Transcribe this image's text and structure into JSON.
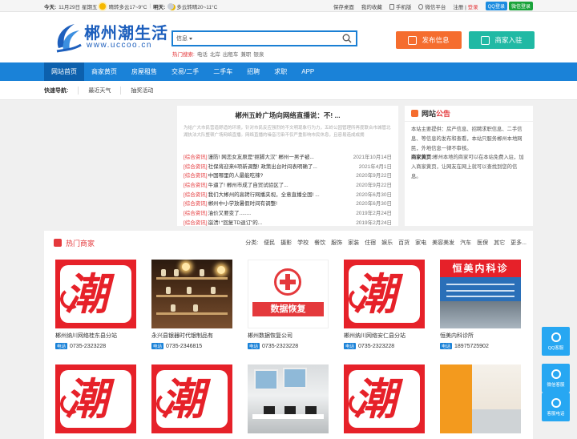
{
  "topbar": {
    "today_label": "今天:",
    "date": "11月29日 星期五",
    "today_weather": "晴转多云17~9°C",
    "tomorrow_label": "明天:",
    "tomorrow_weather": "多云转晴20~11°C",
    "links": [
      "保存桌面",
      "我的收藏",
      "手机版",
      "微信平台"
    ],
    "register": "注册",
    "login": "登录",
    "qq_login": "QQ登录",
    "wechat_login": "微信登录"
  },
  "header": {
    "logo_cn": "郴州潮生活",
    "logo_en": "www.uccoo.cn",
    "search_category": "信息",
    "search_placeholder": "",
    "hot_label": "热门搜索:",
    "hot_words": [
      "电话",
      "北岸",
      "出租车",
      "兼职",
      "银泉"
    ],
    "publish_btn": "发布信息",
    "merchant_btn": "商家入驻"
  },
  "nav": {
    "items": [
      "网站首页",
      "商家黄页",
      "房屋租售",
      "交易/二手",
      "二手车",
      "招聘",
      "求职",
      "APP"
    ]
  },
  "quick": {
    "label": "快速导航:",
    "items": [
      "最近天气",
      "抽奖活动"
    ]
  },
  "news": {
    "title": "郴州五岭广场向网络直播说：不! ...",
    "desc": "为给广大市民营造舒适的环境，针对市民反应强烈的不文明现象行为力，五岭公园管理所再度联合市城管北湖执法大队整顿广场网络直播。网络直播的噪音污染不仅严重影响市民休息，且容易造成成拥",
    "items": [
      {
        "cat": "[综合资讯]",
        "title": "谨防! 网恋女友原是“抠脚大汉” 郴州一男子被...",
        "date": "2021年10月14日"
      },
      {
        "cat": "[综合资讯]",
        "title": "社保将迎来6项新调整! 政策出台时间表明确了...",
        "date": "2021年4月1日"
      },
      {
        "cat": "[综合资讯]",
        "title": "中国哪里的人最能吃辣?",
        "date": "2020年9月22日"
      },
      {
        "cat": "[综合资讯]",
        "title": "牛逼了! 郴州市成了自贸试验区了...",
        "date": "2020年9月22日"
      },
      {
        "cat": "[综合资讯]",
        "title": "我们大郴州的高铐行网播夹视，全意直播全国! ...",
        "date": "2020年6月30日"
      },
      {
        "cat": "[综合资讯]",
        "title": "郴州中小学放暑假时间有调整!",
        "date": "2020年6月30日"
      },
      {
        "cat": "[综合资讯]",
        "title": "油价又要变了........",
        "date": "2019年2月24日"
      },
      {
        "cat": "[综合资讯]",
        "title": "崩溃! “回复TD退订”的...",
        "date": "2019年2月24日"
      }
    ]
  },
  "notice": {
    "title_a": "网站",
    "title_b": "公告",
    "p1": "本站主要提供：房产信息、招聘求职信息、二手信息、等信息的发布和查看，本站只服务郴州本地网民，外地信息一律不审核。",
    "p2_label": "商家黄页:",
    "p2": "郴州本地的商家可以在本站免费入驻，加入商家黄页，让网友在网上就可以查找到您的信息。"
  },
  "merchants": {
    "title": "热门商家",
    "cat_label": "分类:",
    "categories": [
      "便民",
      "摄影",
      "学校",
      "餐饮",
      "服饰",
      "家装",
      "住宿",
      "娱乐",
      "百货",
      "家电",
      "美容美发",
      "汽车",
      "医保",
      "其它",
      "更多..."
    ],
    "phone_tag": "电话",
    "clinic_sign": "恒美内科诊",
    "datarec_band": "数据恢复",
    "items": [
      {
        "name": "郴州纳川网络桂东县分站",
        "phone": "0735-2323228"
      },
      {
        "name": "永兴县银器时代银制品有",
        "phone": "0735-2346815"
      },
      {
        "name": "郴州数据恢复公司",
        "phone": "0735-2323228"
      },
      {
        "name": "郴州纳川网络安仁县分站",
        "phone": "0735-2323228"
      },
      {
        "name": "恒美内科诊所",
        "phone": "18975725902"
      }
    ]
  },
  "side": {
    "items": [
      "QQ客服",
      "微信客服",
      "客服电话"
    ]
  }
}
